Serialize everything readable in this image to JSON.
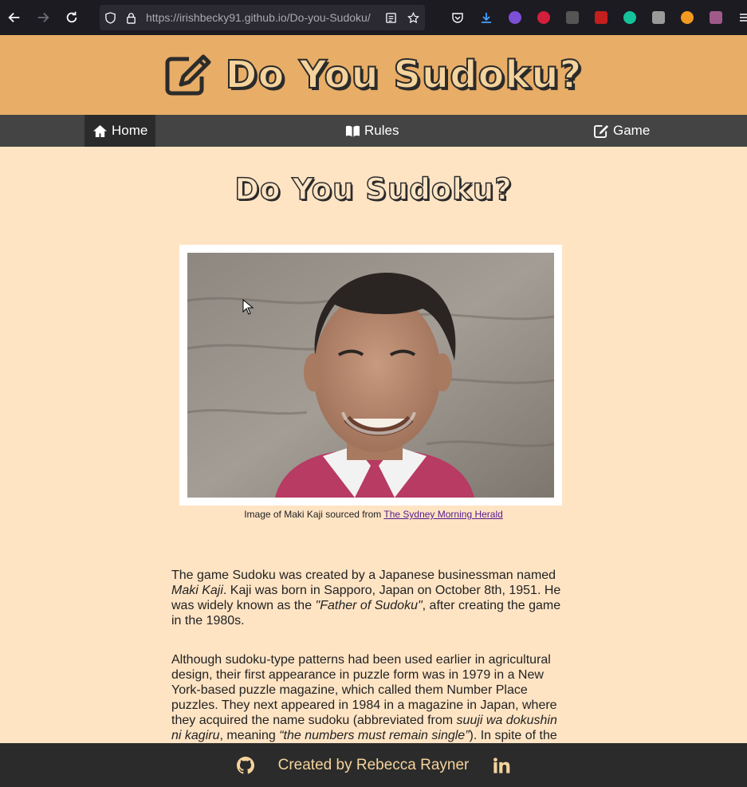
{
  "browser": {
    "url_host": "https://irishbecky91.github.io",
    "url_path": "/Do-you-Sudoku/"
  },
  "header": {
    "title": "Do You Sudoku?",
    "logo_icon": "edit-square-icon"
  },
  "nav": {
    "items": [
      {
        "label": "Home",
        "icon": "home-icon",
        "active": true
      },
      {
        "label": "Rules",
        "icon": "book-icon",
        "active": false
      },
      {
        "label": "Game",
        "icon": "edit-icon",
        "active": false
      }
    ]
  },
  "main": {
    "heading": "Do You Sudoku?",
    "image_caption_prefix": "Image of Maki Kaji sourced from",
    "image_caption_link": "The Sydney Morning Herald",
    "paragraph1": {
      "t1": "The game Sudoku was created by a Japanese businessman named",
      "em1": "Maki Kaji",
      "t2": ". Kaji was born in Sapporo, Japan on October 8th, 1951. He was widely known as the",
      "em2": "\"Father of Sudoku\"",
      "t3": ", after creating the game in the 1980s."
    },
    "paragraph2": {
      "t1": "Although sudoku-type patterns had been used earlier in agricultural design, their first appearance in puzzle form was in 1979 in a New York-based puzzle magazine, which called them Number Place puzzles. They next appeared in 1984 in a magazine in Japan, where they acquired the name sudoku (abbreviated from",
      "em1": "suuji wa dokushin ni kagiru",
      "t2": ", meaning",
      "em2": "“the numbers must remain single”",
      "t3": "). In spite of the"
    }
  },
  "footer": {
    "text": "Created by Rebecca Rayner",
    "left_icon": "github-icon",
    "right_icon": "linkedin-icon"
  },
  "colors": {
    "page_bg": "#ffe4c4",
    "header_bg": "#e8ad66",
    "nav_bg": "#444444",
    "nav_active_bg": "#2b2b2b",
    "footer_bg": "#2b2b2b",
    "footer_text": "#f5d39c"
  }
}
